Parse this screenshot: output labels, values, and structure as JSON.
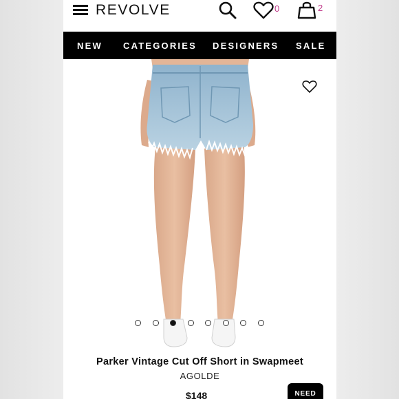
{
  "header": {
    "logo": "REVOLVE",
    "wishlist_count": "0",
    "bag_count": "2"
  },
  "nav": {
    "items": [
      "NEW",
      "CATEGORIES",
      "DESIGNERS",
      "SALE"
    ]
  },
  "gallery": {
    "image_count": 8,
    "active_index": 2
  },
  "product": {
    "title": "Parker Vintage Cut Off Short in Swapmeet",
    "brand": "AGOLDE",
    "price": "$148",
    "action_label": "NEED"
  },
  "colors": {
    "accent": "#c03a8a",
    "nav_bg": "#000000",
    "denim": "#9fc1d8"
  }
}
